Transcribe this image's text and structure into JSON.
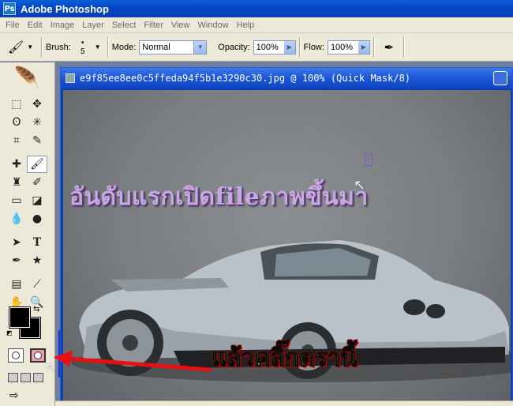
{
  "app": {
    "title": "Adobe Photoshop",
    "logo_text": "Ps"
  },
  "menu": [
    "File",
    "Edit",
    "Image",
    "Layer",
    "Select",
    "Filter",
    "View",
    "Window",
    "Help"
  ],
  "options": {
    "brush_label": "Brush:",
    "brush_size": "5",
    "mode_label": "Mode:",
    "mode_value": "Normal",
    "opacity_label": "Opacity:",
    "opacity_value": "100%",
    "flow_label": "Flow:",
    "flow_value": "100%"
  },
  "document": {
    "title": "e9f85ee8ee0c5ffeda94f5b1e3290c30.jpg @ 100% (Quick Mask/8)",
    "min_label": "_"
  },
  "annotations": {
    "step1": "อันดับแรกเปิดfileภาพขึ้นมา",
    "step2": "แล้วคลิ๊กตรานี้",
    "accent_arrow": "#e81010",
    "accent_text": "#1fd51f"
  },
  "icons": {
    "brush": "brush-icon",
    "airbrush": "airbrush-icon",
    "feather": "feather-icon"
  }
}
